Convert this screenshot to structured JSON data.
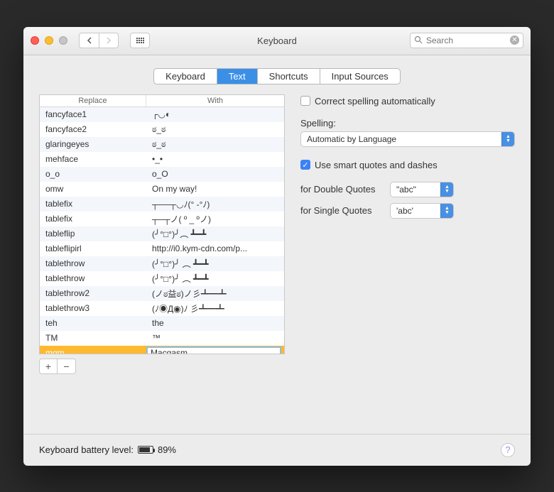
{
  "window_title": "Keyboard",
  "search_placeholder": "Search",
  "tabs": [
    "Keyboard",
    "Text",
    "Shortcuts",
    "Input Sources"
  ],
  "active_tab": "Text",
  "table": {
    "headers": {
      "replace": "Replace",
      "with": "With"
    },
    "rows": [
      {
        "replace": "fancyface1",
        "with": "┌◡◐"
      },
      {
        "replace": "fancyface2",
        "with": "ಠ_ಠ"
      },
      {
        "replace": "glaringeyes",
        "with": "ಠ_ಠ"
      },
      {
        "replace": "mehface",
        "with": "•_•"
      },
      {
        "replace": "o_o",
        "with": "o_O"
      },
      {
        "replace": "omw",
        "with": "On my way!"
      },
      {
        "replace": "tablefix",
        "with": "┬──┬◡ﾉ(° -°ﾉ)"
      },
      {
        "replace": "tablefix",
        "with": "┬─┬ノ( º _ ºノ)"
      },
      {
        "replace": "tableflip",
        "with": "(╯°□°)╯︵ ┻━┻"
      },
      {
        "replace": "tableflipirl",
        "with": "http://i0.kym-cdn.com/p..."
      },
      {
        "replace": "tablethrow",
        "with": "(╯°□°)╯ ︵ ┻━┻"
      },
      {
        "replace": "tablethrow",
        "with": "(╯°□°)╯ ︵ ┻━┻"
      },
      {
        "replace": "tablethrow2",
        "with": "(ノಠ益ಠ)ノ彡┻━┻"
      },
      {
        "replace": "tablethrow3",
        "with": "(ﾉ◉Д◉)ﾉ 彡┻━┻"
      },
      {
        "replace": "teh",
        "with": "the"
      },
      {
        "replace": "TM",
        "with": "™"
      }
    ],
    "editing": {
      "replace": "mgm",
      "with": "Macgasm"
    }
  },
  "right": {
    "correct_spelling": {
      "checked": false,
      "label": "Correct spelling automatically"
    },
    "spelling_label": "Spelling:",
    "spelling_value": "Automatic by Language",
    "smart_quotes": {
      "checked": true,
      "label": "Use smart quotes and dashes"
    },
    "double_label": "for Double Quotes",
    "double_value": "\"abc\"",
    "single_label": "for Single Quotes",
    "single_value": "'abc'"
  },
  "footer": {
    "battery_label": "Keyboard battery level:",
    "battery_percent": "89%"
  }
}
